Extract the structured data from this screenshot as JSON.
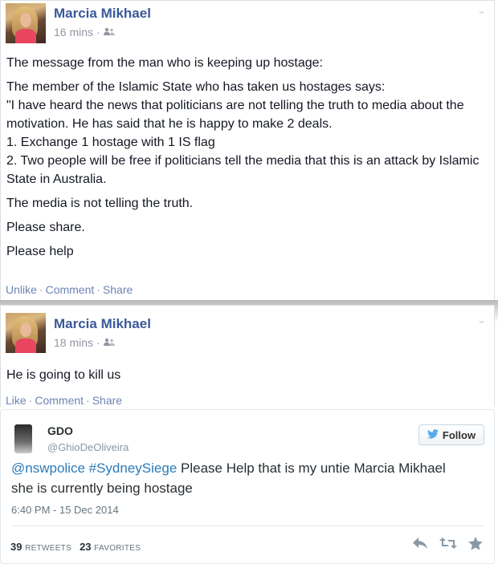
{
  "posts": [
    {
      "author": "Marcia Mikhael",
      "time": "16 mins",
      "sep": "·",
      "audience_icon": "friends-icon",
      "paragraphs": [
        "The message from the man who is keeping up hostage:",
        "The member of the Islamic State who has taken us hostages says:\n\"I have heard the news that politicians are not telling the truth to media about the motivation. He has said that he is happy to make 2 deals.\n1. Exchange 1 hostage with 1 IS flag\n2. Two people will be free if politicians tell the media that this is an attack by Islamic State in Australia.",
        "The media is not telling the truth.",
        "Please share.",
        "Please help"
      ],
      "actions": [
        "Unlike",
        "Comment",
        "Share"
      ]
    },
    {
      "author": "Marcia Mikhael",
      "time": "18 mins",
      "sep": "·",
      "audience_icon": "friends-icon",
      "paragraphs": [
        "He is going to kill us"
      ],
      "actions": [
        "Like",
        "Comment",
        "Share"
      ]
    }
  ],
  "tweet": {
    "name": "GDO",
    "handle": "@GhioDeOliveira",
    "follow_label": "Follow",
    "mention": "@nswpolice",
    "hashtag": "#SydneySiege",
    "text": " Please Help that is my untie Marcia Mikhael she is currently being hostage",
    "timestamp": "6:40 PM - 15 Dec 2014",
    "retweets": "39",
    "retweets_label": "RETWEETS",
    "favorites": "23",
    "favorites_label": "FAVORITES",
    "icons": [
      "reply-icon",
      "retweet-icon",
      "favorite-icon"
    ]
  },
  "colors": {
    "fb_link": "#3b5998",
    "tw_blue": "#2b7bb9"
  }
}
